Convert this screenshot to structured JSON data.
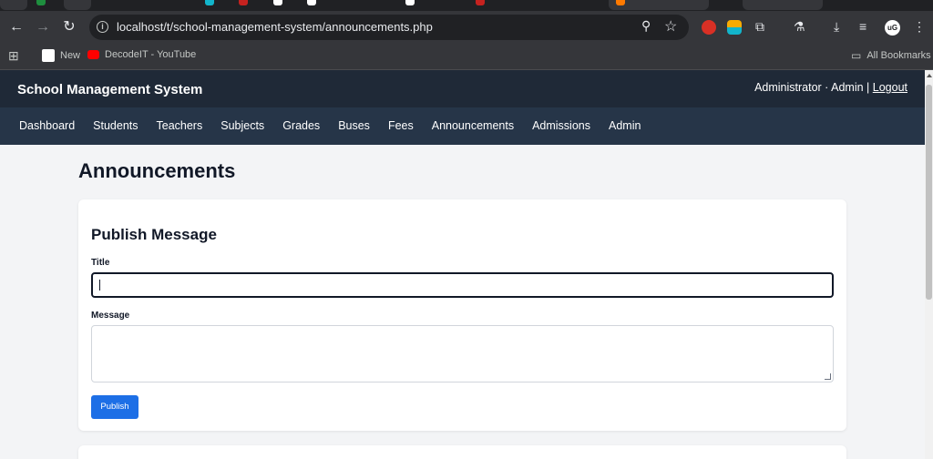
{
  "browser": {
    "url": "localhost/t/school-management-system/announcements.php",
    "bookmarks": [
      {
        "label": "New",
        "color": "#ffffff"
      },
      {
        "label": "DecodeIT - YouTube",
        "color": "#ff0000"
      }
    ],
    "all_bookmarks": "All Bookmarks",
    "avatar_text": "uG"
  },
  "header": {
    "title": "School Management System",
    "user": "Administrator · Admin |",
    "logout": "Logout"
  },
  "nav": [
    "Dashboard",
    "Students",
    "Teachers",
    "Subjects",
    "Grades",
    "Buses",
    "Fees",
    "Announcements",
    "Admissions",
    "Admin"
  ],
  "page": {
    "title": "Announcements",
    "form": {
      "heading": "Publish Message",
      "title_label": "Title",
      "title_value": "",
      "message_label": "Message",
      "message_value": "",
      "submit_label": "Publish"
    }
  },
  "colors": {
    "header_bg": "#1f2937",
    "nav_bg": "#263548",
    "accent": "#1d6fe6"
  }
}
